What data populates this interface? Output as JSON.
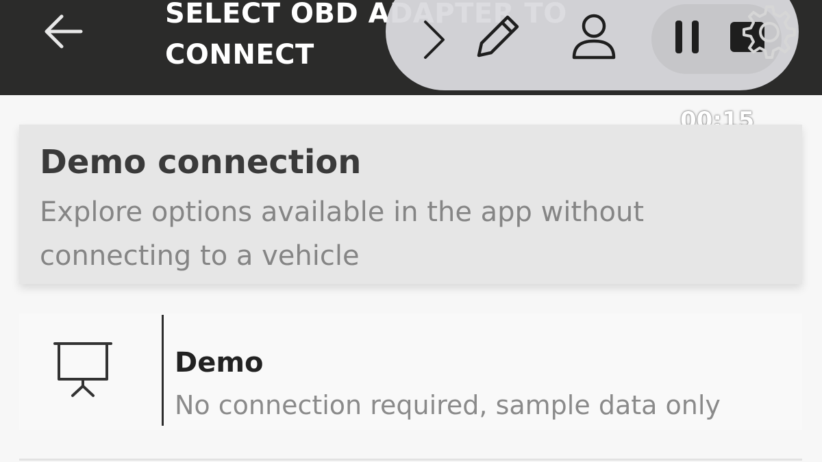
{
  "header": {
    "title": "SELECT OBD ADAPTER TO CONNECT",
    "back_icon": "arrow-left-icon",
    "background_color": "#2b2b2a"
  },
  "overlay_toolbar": {
    "icons": [
      "chevron-right-icon",
      "pencil-icon",
      "user-icon",
      "pause-icon",
      "stop-icon",
      "gear-icon"
    ],
    "timer": "00:15"
  },
  "demo_card": {
    "title": "Demo connection",
    "description": "Explore options available in the app without connecting to a vehicle"
  },
  "list_items": [
    {
      "icon": "presentation-board-icon",
      "title": "Demo",
      "subtitle": "No connection required, sample data only"
    }
  ]
}
